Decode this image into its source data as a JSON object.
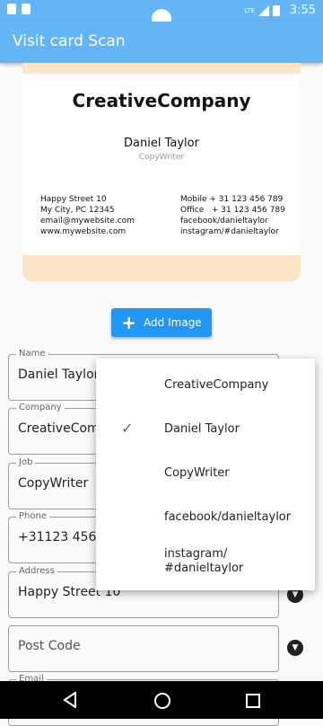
{
  "status_bar": {
    "time": "3:55",
    "network": "LTE"
  },
  "app_bar": {
    "title": "Visit card Scan"
  },
  "card": {
    "company": "CreativeCompany",
    "name": "Daniel Taylor",
    "role": "CopyWriter",
    "left_lines": [
      "Happy Street 10",
      "My City, PC 12345",
      "email@mywebsite.com",
      "www.mywebsite.com"
    ],
    "right_lines": [
      "Mobile + 31 123 456 789",
      "Office   + 31 123 456 789",
      "facebook/danieltaylor",
      "instagram/#danieltaylor"
    ]
  },
  "add_image_button": {
    "label": "Add Image",
    "icon": "plus-icon"
  },
  "form": {
    "name": {
      "label": "Name",
      "value": "Daniel Taylor"
    },
    "company": {
      "label": "Company",
      "value": "CreativeCompany"
    },
    "job": {
      "label": "Job",
      "value": "CopyWriter"
    },
    "phone": {
      "label": "Phone",
      "value": "+31123 456 789"
    },
    "address": {
      "label": "Address",
      "value": "Happy Street 10"
    },
    "post_code": {
      "placeholder": "Post Code"
    },
    "email": {
      "label": "Email"
    }
  },
  "dropdown_menu": {
    "selected": "Daniel Taylor",
    "options": [
      "CreativeCompany",
      "Daniel Taylor",
      "CopyWriter",
      "facebook/danieltaylor",
      "instagram/\n#danieltaylor"
    ]
  },
  "colors": {
    "app_bar": "#64b5f6",
    "button": "#2196f3",
    "card_background": "#fde4c4"
  }
}
